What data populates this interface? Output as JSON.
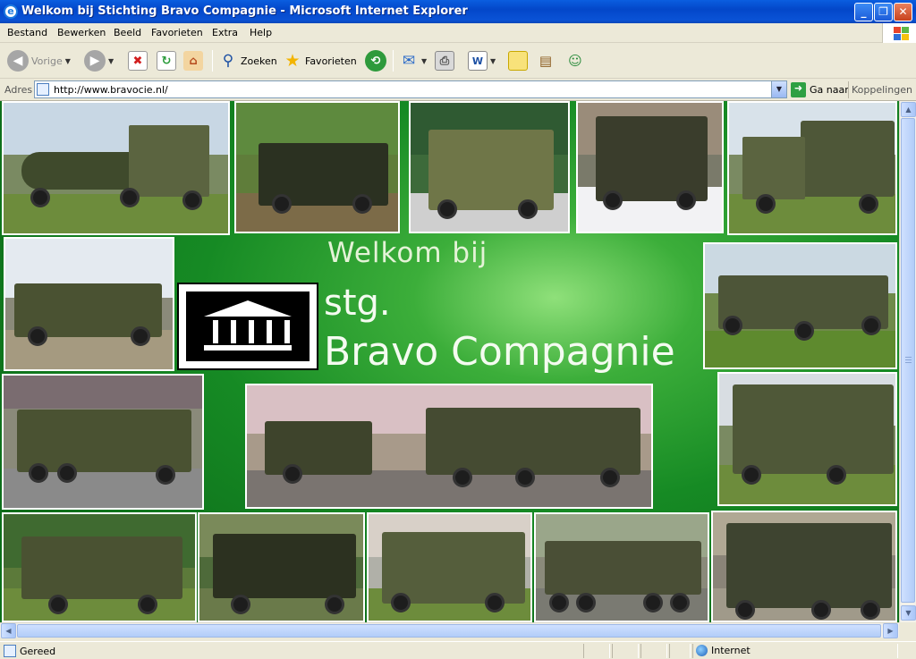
{
  "window": {
    "title": "Welkom bij Stichting Bravo Compagnie - Microsoft Internet Explorer"
  },
  "menu": [
    "Bestand",
    "Bewerken",
    "Beeld",
    "Favorieten",
    "Extra",
    "Help"
  ],
  "toolbar": {
    "back_label": "Vorige",
    "search_label": "Zoeken",
    "favorites_label": "Favorieten"
  },
  "address": {
    "label": "Adres",
    "url": "http://www.bravocie.nl/",
    "go_label": "Ga naar",
    "links_label": "Koppelingen"
  },
  "page": {
    "welcome": "Welkom bij",
    "org_line1": "stg.",
    "org_line2": "Bravo Compagnie"
  },
  "status": {
    "text": "Gereed",
    "zone": "Internet"
  },
  "colors": {
    "page_green": "#168a24",
    "titlebar_blue": "#0347c9"
  }
}
